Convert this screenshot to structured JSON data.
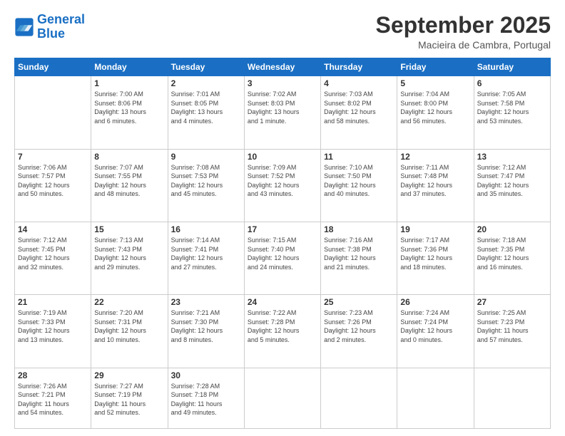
{
  "logo": {
    "text_general": "General",
    "text_blue": "Blue"
  },
  "header": {
    "month": "September 2025",
    "location": "Macieira de Cambra, Portugal"
  },
  "weekdays": [
    "Sunday",
    "Monday",
    "Tuesday",
    "Wednesday",
    "Thursday",
    "Friday",
    "Saturday"
  ],
  "weeks": [
    [
      {
        "day": "",
        "info": ""
      },
      {
        "day": "1",
        "info": "Sunrise: 7:00 AM\nSunset: 8:06 PM\nDaylight: 13 hours\nand 6 minutes."
      },
      {
        "day": "2",
        "info": "Sunrise: 7:01 AM\nSunset: 8:05 PM\nDaylight: 13 hours\nand 4 minutes."
      },
      {
        "day": "3",
        "info": "Sunrise: 7:02 AM\nSunset: 8:03 PM\nDaylight: 13 hours\nand 1 minute."
      },
      {
        "day": "4",
        "info": "Sunrise: 7:03 AM\nSunset: 8:02 PM\nDaylight: 12 hours\nand 58 minutes."
      },
      {
        "day": "5",
        "info": "Sunrise: 7:04 AM\nSunset: 8:00 PM\nDaylight: 12 hours\nand 56 minutes."
      },
      {
        "day": "6",
        "info": "Sunrise: 7:05 AM\nSunset: 7:58 PM\nDaylight: 12 hours\nand 53 minutes."
      }
    ],
    [
      {
        "day": "7",
        "info": "Sunrise: 7:06 AM\nSunset: 7:57 PM\nDaylight: 12 hours\nand 50 minutes."
      },
      {
        "day": "8",
        "info": "Sunrise: 7:07 AM\nSunset: 7:55 PM\nDaylight: 12 hours\nand 48 minutes."
      },
      {
        "day": "9",
        "info": "Sunrise: 7:08 AM\nSunset: 7:53 PM\nDaylight: 12 hours\nand 45 minutes."
      },
      {
        "day": "10",
        "info": "Sunrise: 7:09 AM\nSunset: 7:52 PM\nDaylight: 12 hours\nand 43 minutes."
      },
      {
        "day": "11",
        "info": "Sunrise: 7:10 AM\nSunset: 7:50 PM\nDaylight: 12 hours\nand 40 minutes."
      },
      {
        "day": "12",
        "info": "Sunrise: 7:11 AM\nSunset: 7:48 PM\nDaylight: 12 hours\nand 37 minutes."
      },
      {
        "day": "13",
        "info": "Sunrise: 7:12 AM\nSunset: 7:47 PM\nDaylight: 12 hours\nand 35 minutes."
      }
    ],
    [
      {
        "day": "14",
        "info": "Sunrise: 7:12 AM\nSunset: 7:45 PM\nDaylight: 12 hours\nand 32 minutes."
      },
      {
        "day": "15",
        "info": "Sunrise: 7:13 AM\nSunset: 7:43 PM\nDaylight: 12 hours\nand 29 minutes."
      },
      {
        "day": "16",
        "info": "Sunrise: 7:14 AM\nSunset: 7:41 PM\nDaylight: 12 hours\nand 27 minutes."
      },
      {
        "day": "17",
        "info": "Sunrise: 7:15 AM\nSunset: 7:40 PM\nDaylight: 12 hours\nand 24 minutes."
      },
      {
        "day": "18",
        "info": "Sunrise: 7:16 AM\nSunset: 7:38 PM\nDaylight: 12 hours\nand 21 minutes."
      },
      {
        "day": "19",
        "info": "Sunrise: 7:17 AM\nSunset: 7:36 PM\nDaylight: 12 hours\nand 18 minutes."
      },
      {
        "day": "20",
        "info": "Sunrise: 7:18 AM\nSunset: 7:35 PM\nDaylight: 12 hours\nand 16 minutes."
      }
    ],
    [
      {
        "day": "21",
        "info": "Sunrise: 7:19 AM\nSunset: 7:33 PM\nDaylight: 12 hours\nand 13 minutes."
      },
      {
        "day": "22",
        "info": "Sunrise: 7:20 AM\nSunset: 7:31 PM\nDaylight: 12 hours\nand 10 minutes."
      },
      {
        "day": "23",
        "info": "Sunrise: 7:21 AM\nSunset: 7:30 PM\nDaylight: 12 hours\nand 8 minutes."
      },
      {
        "day": "24",
        "info": "Sunrise: 7:22 AM\nSunset: 7:28 PM\nDaylight: 12 hours\nand 5 minutes."
      },
      {
        "day": "25",
        "info": "Sunrise: 7:23 AM\nSunset: 7:26 PM\nDaylight: 12 hours\nand 2 minutes."
      },
      {
        "day": "26",
        "info": "Sunrise: 7:24 AM\nSunset: 7:24 PM\nDaylight: 12 hours\nand 0 minutes."
      },
      {
        "day": "27",
        "info": "Sunrise: 7:25 AM\nSunset: 7:23 PM\nDaylight: 11 hours\nand 57 minutes."
      }
    ],
    [
      {
        "day": "28",
        "info": "Sunrise: 7:26 AM\nSunset: 7:21 PM\nDaylight: 11 hours\nand 54 minutes."
      },
      {
        "day": "29",
        "info": "Sunrise: 7:27 AM\nSunset: 7:19 PM\nDaylight: 11 hours\nand 52 minutes."
      },
      {
        "day": "30",
        "info": "Sunrise: 7:28 AM\nSunset: 7:18 PM\nDaylight: 11 hours\nand 49 minutes."
      },
      {
        "day": "",
        "info": ""
      },
      {
        "day": "",
        "info": ""
      },
      {
        "day": "",
        "info": ""
      },
      {
        "day": "",
        "info": ""
      }
    ]
  ]
}
